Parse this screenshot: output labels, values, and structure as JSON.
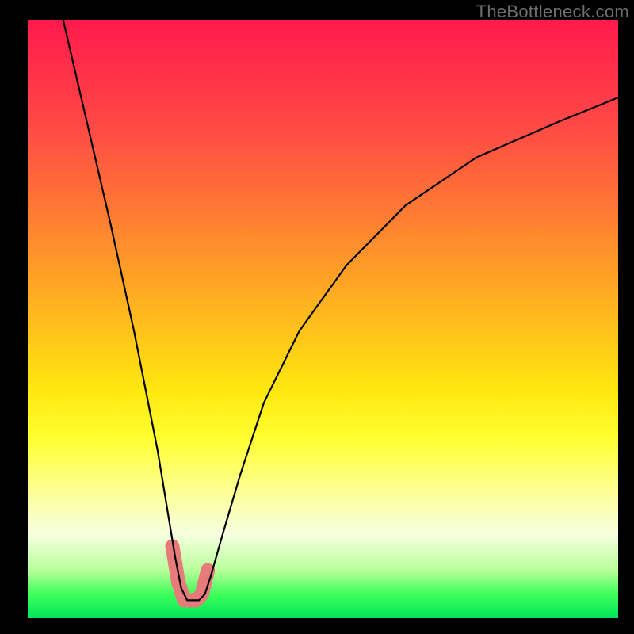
{
  "watermark": "TheBottleneck.com",
  "chart_data": {
    "type": "line",
    "title": "",
    "xlabel": "",
    "ylabel": "",
    "xlim": [
      0,
      100
    ],
    "ylim": [
      0,
      100
    ],
    "grid": false,
    "legend_position": "none",
    "background_gradient": {
      "top": "#ff1a4d",
      "bottom": "#00e55a",
      "meaning": "red (top) = high bottleneck, green (bottom) = no bottleneck"
    },
    "series": [
      {
        "name": "bottleneck-curve",
        "color": "#000000",
        "x": [
          6,
          10,
          14,
          18,
          20,
          22,
          24,
          25,
          26,
          27,
          28,
          29,
          30,
          31,
          33,
          36,
          40,
          46,
          54,
          64,
          76,
          90,
          100
        ],
        "y": [
          100,
          83,
          66,
          48,
          38,
          28,
          16,
          10,
          5,
          3,
          3,
          3,
          4,
          7,
          14,
          24,
          36,
          48,
          59,
          69,
          77,
          83,
          87
        ]
      },
      {
        "name": "highlight-range",
        "color": "#e77b7b",
        "x": [
          24.5,
          25.5,
          26.5,
          27.5,
          28.5,
          29.5,
          30.5
        ],
        "y": [
          12,
          6,
          3,
          3,
          3,
          4,
          8
        ]
      }
    ],
    "annotations": []
  }
}
